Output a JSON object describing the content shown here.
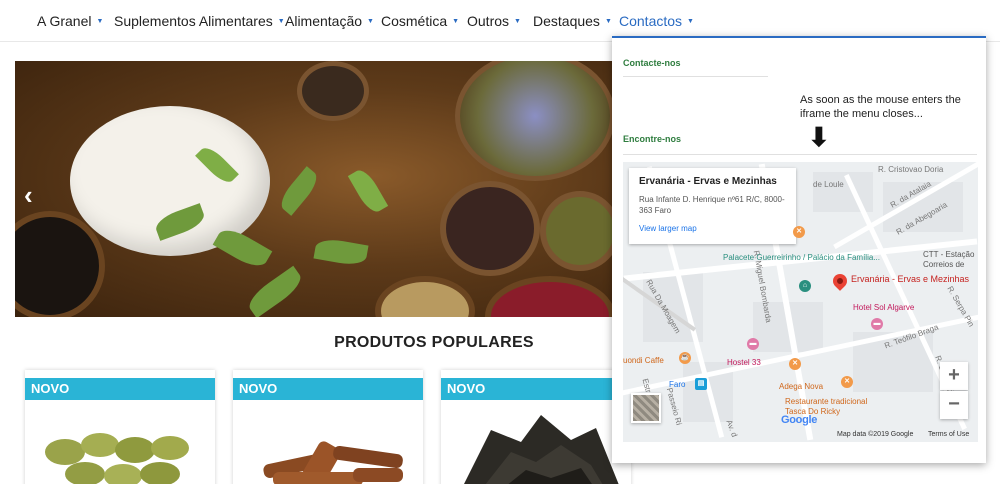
{
  "nav": {
    "items": [
      {
        "label": "A Granel"
      },
      {
        "label": "Suplementos Alimentares"
      },
      {
        "label": "Alimentação"
      },
      {
        "label": "Cosmética"
      },
      {
        "label": "Outros"
      },
      {
        "label": "Destaques"
      },
      {
        "label": "Contactos"
      }
    ],
    "caret": "▼"
  },
  "hero": {
    "prev_arrow": "‹"
  },
  "products": {
    "title": "PRODUTOS POPULARES",
    "cards": [
      {
        "badge": "NOVO"
      },
      {
        "badge": "NOVO"
      },
      {
        "badge": "NOVO"
      }
    ]
  },
  "dropdown": {
    "contact_heading": "Contacte-nos",
    "find_heading": "Encontre-nos",
    "note": "As soon as the mouse enters the iframe the menu closes...",
    "note_arrow": "⬇"
  },
  "map": {
    "place_name": "Ervanária - Ervas e Mezinhas",
    "address": "Rua Infante D. Henrique nº61 R/C, 8000-363 Faro",
    "larger_map_link": "View larger map",
    "labels": {
      "pin_label": "Ervanária - Ervas e Mezinhas",
      "palace": "Palacete Guerreirinho / Palácio da Família...",
      "hotel": "Hotel Sol Algarve",
      "ctt": "CTT - Estação Correios de",
      "hostel": "Hostel 33",
      "adega": "Adega Nova",
      "restaurant": "Restaurante tradicional Tasca Do Ricky",
      "cafe": "uondi Caffe",
      "faro": "Faro",
      "street_cristovao": "R. Cristovao Doria",
      "street_atalaia": "R. da Atalaia",
      "street_abegoaria": "R. da Abegoaria",
      "street_loule": "de Loule",
      "street_bombarda": "R. Miguel Bombarda",
      "street_moagem": "Rua Da Moagem",
      "street_braga": "R. Teófilo Braga",
      "street_vitoria": "R. da Vitória",
      "street_serpa": "R. Serpa Pin",
      "street_passeio": "Passeio Ri",
      "street_est": "Estr.",
      "street_av": "Av. d"
    },
    "zoom_in": "+",
    "zoom_out": "−",
    "google": "Google",
    "map_data": "Map data ©2019 Google",
    "terms": "Terms of Use"
  },
  "colors": {
    "accent": "#2a6bc2",
    "badge": "#2ab4d6",
    "heading_green": "#2f7d3f",
    "pin_red": "#ea4335"
  }
}
